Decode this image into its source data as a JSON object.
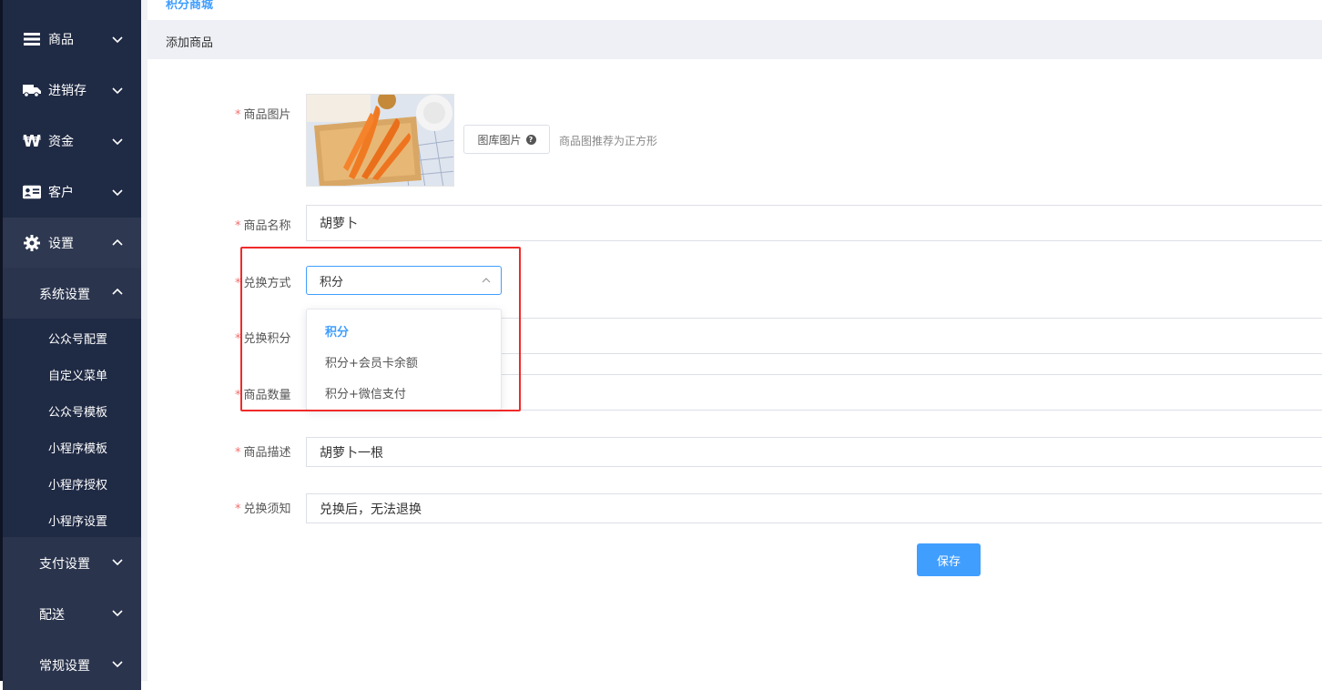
{
  "sidebar": {
    "groups": [
      {
        "label": "商品",
        "icon": "menu-icon"
      },
      {
        "label": "进销存",
        "icon": "truck-icon"
      },
      {
        "label": "资金",
        "icon": "won-icon"
      },
      {
        "label": "客户",
        "icon": "id-card-icon"
      },
      {
        "label": "设置",
        "icon": "gear-icon"
      }
    ],
    "settings_sub": {
      "label": "系统设置",
      "items": [
        "公众号配置",
        "自定义菜单",
        "公众号模板",
        "小程序模板",
        "小程序授权",
        "小程序设置"
      ]
    },
    "other_subs": [
      "支付设置",
      "配送",
      "常规设置"
    ]
  },
  "breadcrumb": "积分商城",
  "page_title": "添加商品",
  "form": {
    "image_label": "商品图片",
    "library_button": "图库图片",
    "image_hint": "商品图推荐为正方形",
    "name_label": "商品名称",
    "name_value": "胡萝卜",
    "exchange_label": "兑换方式",
    "exchange_value": "积分",
    "exchange_options": [
      "积分",
      "积分+会员卡余额",
      "积分+微信支付"
    ],
    "points_label": "兑换积分",
    "quantity_label": "商品数量",
    "desc_label": "商品描述",
    "desc_value": "胡萝卜一根",
    "notice_label": "兑换须知",
    "notice_value": "兑换后，无法退换",
    "save_button": "保存"
  },
  "colors": {
    "sidebar_bg": "#1f2a44",
    "accent": "#409eff",
    "required": "#f56c6c",
    "highlight_box": "#f02a2a"
  }
}
